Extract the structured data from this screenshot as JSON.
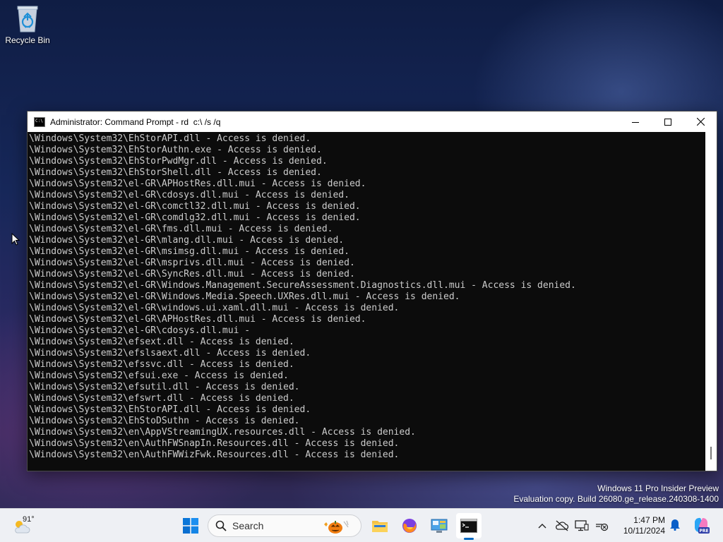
{
  "desktop": {
    "recycle_bin_label": "Recycle Bin"
  },
  "window": {
    "title": "Administrator: Command Prompt - rd  c:\\ /s /q",
    "lines": [
      "\\Windows\\System32\\EhStorAPI.dll - Access is denied.",
      "\\Windows\\System32\\EhStorAuthn.exe - Access is denied.",
      "\\Windows\\System32\\EhStorPwdMgr.dll - Access is denied.",
      "\\Windows\\System32\\EhStorShell.dll - Access is denied.",
      "\\Windows\\System32\\el-GR\\APHostRes.dll.mui - Access is denied.",
      "\\Windows\\System32\\el-GR\\cdosys.dll.mui - Access is denied.",
      "\\Windows\\System32\\el-GR\\comctl32.dll.mui - Access is denied.",
      "\\Windows\\System32\\el-GR\\comdlg32.dll.mui - Access is denied.",
      "\\Windows\\System32\\el-GR\\fms.dll.mui - Access is denied.",
      "\\Windows\\System32\\el-GR\\mlang.dll.mui - Access is denied.",
      "\\Windows\\System32\\el-GR\\msimsg.dll.mui - Access is denied.",
      "\\Windows\\System32\\el-GR\\msprivs.dll.mui - Access is denied.",
      "\\Windows\\System32\\el-GR\\SyncRes.dll.mui - Access is denied.",
      "\\Windows\\System32\\el-GR\\Windows.Management.SecureAssessment.Diagnostics.dll.mui - Access is denied.",
      "\\Windows\\System32\\el-GR\\Windows.Media.Speech.UXRes.dll.mui - Access is denied.",
      "\\Windows\\System32\\el-GR\\windows.ui.xaml.dll.mui - Access is denied.",
      "\\Windows\\System32\\el-GR\\APHostRes.dll.mui - Access is denied.",
      "\\Windows\\System32\\el-GR\\cdosys.dll.mui -",
      "\\Windows\\System32\\efsext.dll - Access is denied.",
      "\\Windows\\System32\\efslsaext.dll - Access is denied.",
      "\\Windows\\System32\\efssvc.dll - Access is denied.",
      "\\Windows\\System32\\efsui.exe - Access is denied.",
      "\\Windows\\System32\\efsutil.dll - Access is denied.",
      "\\Windows\\System32\\efswrt.dll - Access is denied.",
      "\\Windows\\System32\\EhStorAPI.dll - Access is denied.",
      "\\Windows\\System32\\EhStoDSuthn - Access is denied.",
      "\\Windows\\System32\\en\\AppVStreamingUX.resources.dll - Access is denied.",
      "\\Windows\\System32\\en\\AuthFWSnapIn.Resources.dll - Access is denied.",
      "\\Windows\\System32\\en\\AuthFWWizFwk.Resources.dll - Access is denied."
    ]
  },
  "watermark": {
    "line1": "Windows 11 Pro Insider Preview",
    "line2": "Evaluation copy. Build 26080.ge_release.240308-1400"
  },
  "taskbar": {
    "weather_temp": "91°",
    "search_placeholder": "Search",
    "time": "1:47 PM",
    "date": "10/11/2024"
  },
  "colors": {
    "console_bg": "#0c0c0c",
    "console_fg": "#cccccc",
    "accent": "#0067c0"
  }
}
